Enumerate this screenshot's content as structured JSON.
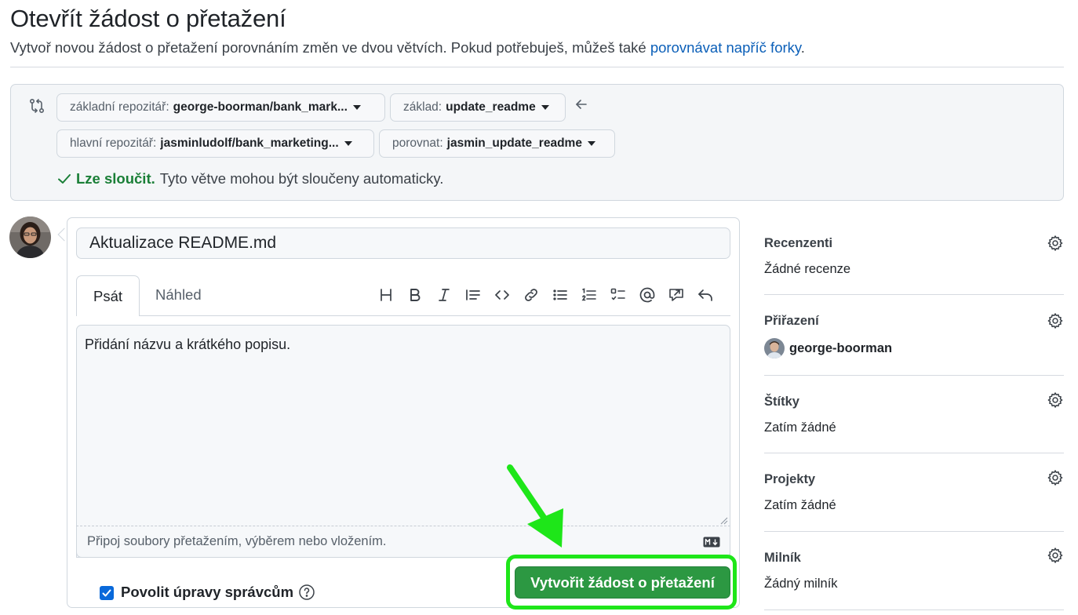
{
  "header": {
    "title": "Otevřít žádost o přetažení",
    "subtitle_prefix": "Vytvoř novou žádost o přetažení porovnáním změn ve dvou větvích. Pokud potřebuješ, můžeš také ",
    "subtitle_link": "porovnávat napříč forky",
    "subtitle_suffix": "."
  },
  "compare": {
    "base_repo_label": "základní repozitář:",
    "base_repo_value": "george-boorman/bank_mark...",
    "base_label": "základ:",
    "base_value": "update_readme",
    "head_repo_label": "hlavní repozitář:",
    "head_repo_value": "jasminludolf/bank_marketing...",
    "compare_label": "porovnat:",
    "compare_value": "jasmin_update_readme",
    "status_ok": "Lze sloučit.",
    "status_text": "Tyto větve mohou být sloučeny automaticky."
  },
  "editor": {
    "title_value": "Aktualizace README.md",
    "tab_write": "Psát",
    "tab_preview": "Náhled",
    "toolbar_icons": [
      "heading-icon",
      "bold-icon",
      "italic-icon",
      "quote-icon",
      "code-icon",
      "link-icon",
      "unordered-list-icon",
      "ordered-list-icon",
      "task-list-icon",
      "mention-icon",
      "reference-icon",
      "undo-icon"
    ],
    "body_text": "Přidání názvu a krátkého popisu.",
    "attach_hint": "Připoj soubory přetažením, výběrem nebo vložením.",
    "allow_edits_label": "Povolit úpravy správcům",
    "allow_edits_checked": true,
    "create_button": "Vytvořit žádost o přetažení"
  },
  "sidebar": {
    "reviewers_title": "Recenzenti",
    "reviewers_value": "Žádné recenze",
    "assignees_title": "Přiřazení",
    "assignees_value": "george-boorman",
    "labels_title": "Štítky",
    "labels_value": "Zatím žádné",
    "projects_title": "Projekty",
    "projects_value": "Zatím žádné",
    "milestone_title": "Milník",
    "milestone_value": "Žádný milník"
  },
  "colors": {
    "accent_blue": "#0969da",
    "success_green": "#1a7f37",
    "button_green": "#2c9842",
    "highlight_green": "#1ee619"
  }
}
